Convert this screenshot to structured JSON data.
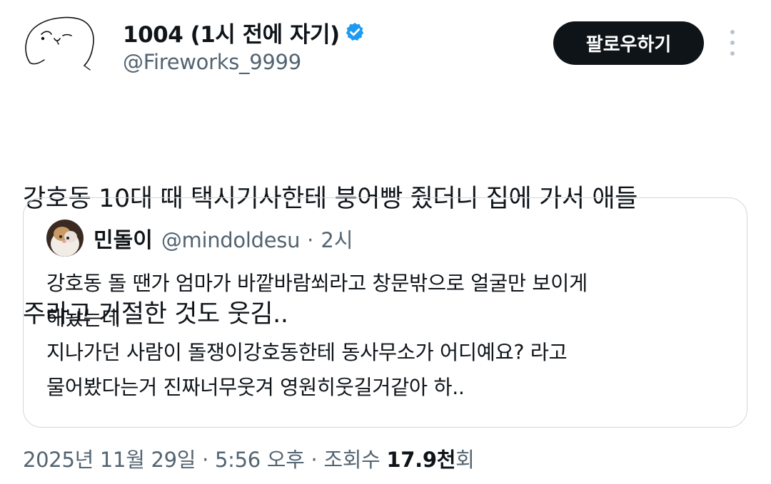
{
  "tweet": {
    "author": {
      "display_name": "1004 (1시 전에 자기)",
      "handle": "@Fireworks_9999",
      "verified": true
    },
    "follow_label": "팔로우하기",
    "text_lines": [
      "강호동 10대 때 택시기사한테 붕어빵 줬더니 집에 가서 애들",
      "주라고 거절한 것도 웃김.."
    ]
  },
  "quote": {
    "display_name": "민돌이",
    "handle": "@mindoldesu",
    "separator": "·",
    "time": "2시",
    "lines": [
      "강호동 돌 땐가 엄마가 바깥바람쐬라고 창문밖으로 얼굴만 보이게",
      "해놨는데",
      "지나가던 사람이 돌쟁이강호동한테 동사무소가 어디예요? 라고",
      "물어봤다는거 진짜너무웃겨 영원히웃길거같아  하.."
    ]
  },
  "meta": {
    "date": "2025년 11월 29일",
    "sep1": " · ",
    "time": "5:56 오후",
    "sep2": " · ",
    "views_label": "조회수 ",
    "views_count": "17.9천",
    "views_suffix": "회"
  },
  "colors": {
    "text_primary": "#0f1419",
    "text_secondary": "#536471",
    "verified_blue": "#1d9bf0",
    "follow_bg": "#0f1419",
    "border": "#cfd9de"
  },
  "icons": {
    "verified": "verified-badge-icon",
    "more": "more-vertical-icon"
  }
}
